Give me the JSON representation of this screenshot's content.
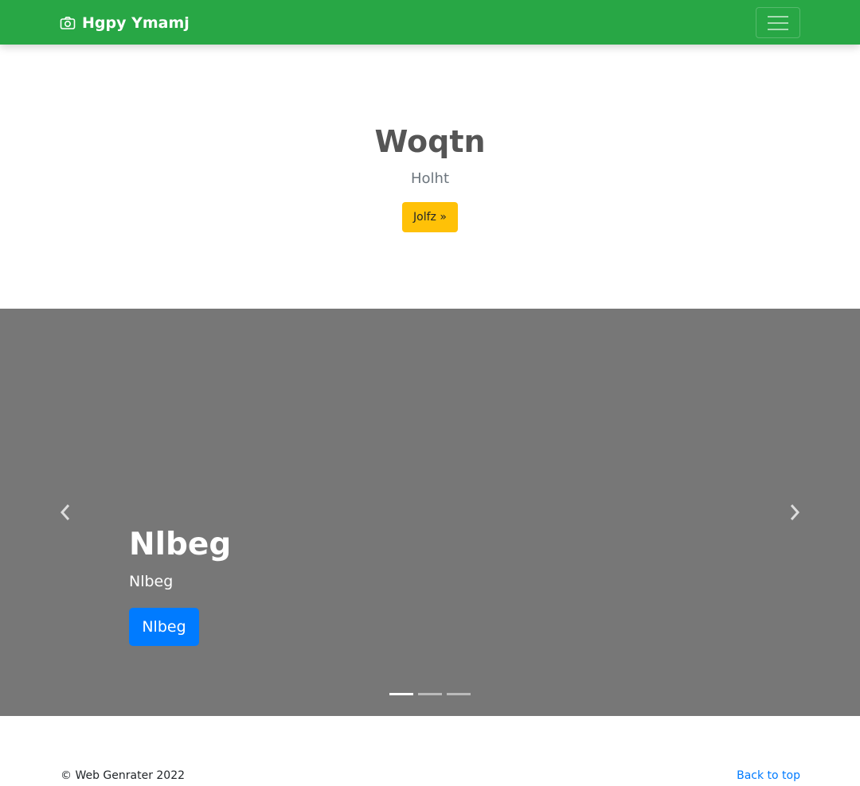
{
  "navbar": {
    "brand_icon": "camera-icon",
    "brand_text": "Hgpy Ymamj",
    "toggler_icon": "hamburger-menu-icon",
    "background": "#28a745"
  },
  "hero": {
    "title": "Woqtn",
    "subtitle": "Holht",
    "button_label": "Jolfz »",
    "button_color": "#ffc107"
  },
  "carousel": {
    "background": "#777777",
    "prev_icon": "chevron-left-icon",
    "next_icon": "chevron-right-icon",
    "slides": [
      {
        "title": "Nlbeg",
        "text": "Nlbeg",
        "button_label": "Nlbeg"
      }
    ],
    "indicator_count": 3,
    "active_indicator": 0,
    "button_color": "#007bff"
  },
  "footer": {
    "copyright": "© Web Genrater 2022",
    "back_to_top": "Back to top",
    "link_color": "#007bff"
  }
}
